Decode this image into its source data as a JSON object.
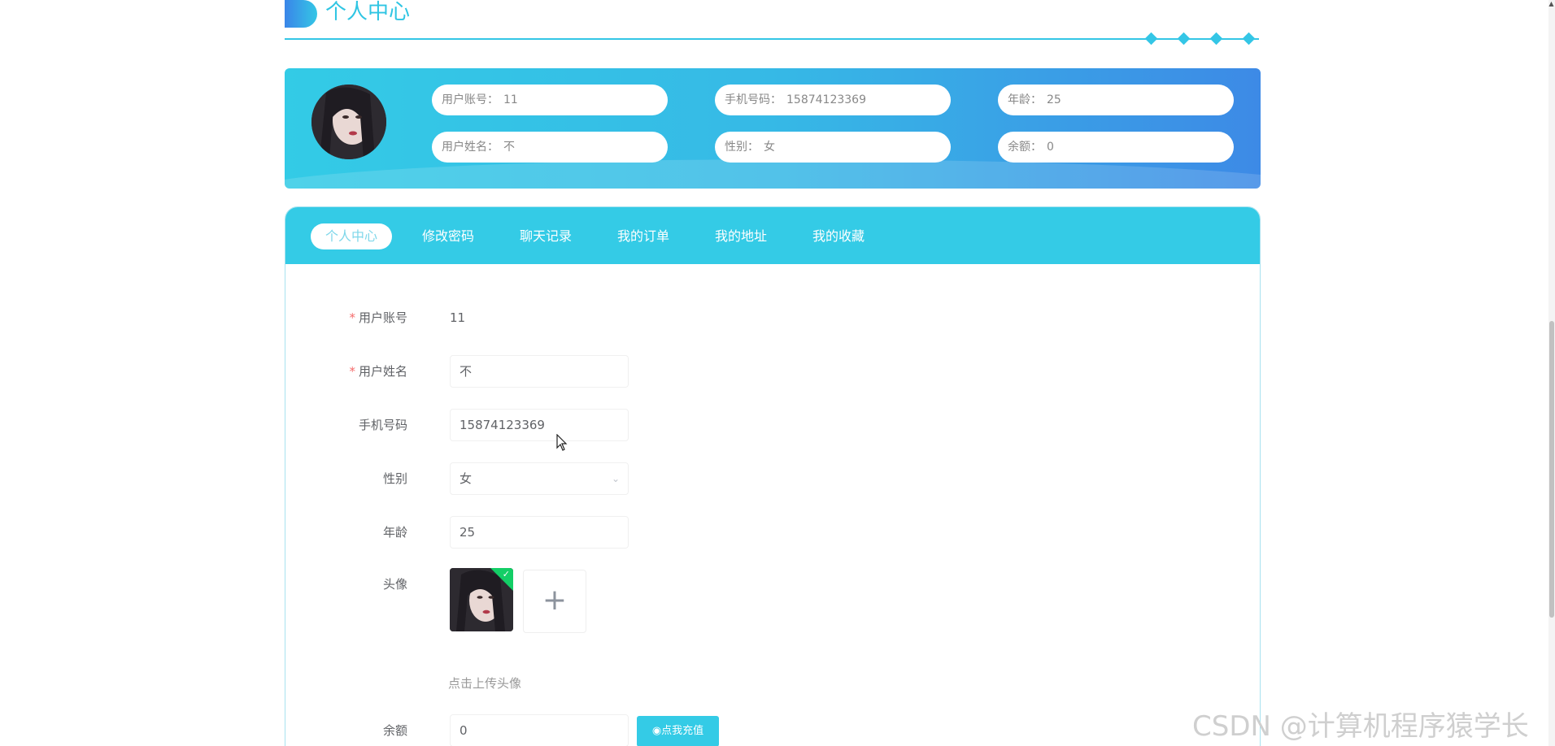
{
  "header": {
    "title": "个人中心"
  },
  "info": {
    "items": [
      {
        "label": "用户账号：",
        "value": "11"
      },
      {
        "label": "手机号码：",
        "value": "15874123369"
      },
      {
        "label": "年龄：",
        "value": "25"
      },
      {
        "label": "用户姓名：",
        "value": "不"
      },
      {
        "label": "性别：",
        "value": "女"
      },
      {
        "label": "余额：",
        "value": "0"
      }
    ]
  },
  "tabs": [
    {
      "label": "个人中心"
    },
    {
      "label": "修改密码"
    },
    {
      "label": "聊天记录"
    },
    {
      "label": "我的订单"
    },
    {
      "label": "我的地址"
    },
    {
      "label": "我的收藏"
    }
  ],
  "form": {
    "account_label": "用户账号",
    "account_value": "11",
    "name_label": "用户姓名",
    "name_value": "不",
    "phone_label": "手机号码",
    "phone_value": "15874123369",
    "gender_label": "性别",
    "gender_value": "女",
    "age_label": "年龄",
    "age_value": "25",
    "avatar_label": "头像",
    "upload_hint": "点击上传头像",
    "balance_label": "余额",
    "balance_value": "0",
    "recharge_label": "点我充值"
  },
  "watermark": "CSDN @计算机程序猿学长",
  "colors": {
    "accent": "#34cbe6",
    "accent_blue": "#3d8ae6",
    "required": "#f56c6c",
    "success": "#13ce66"
  }
}
